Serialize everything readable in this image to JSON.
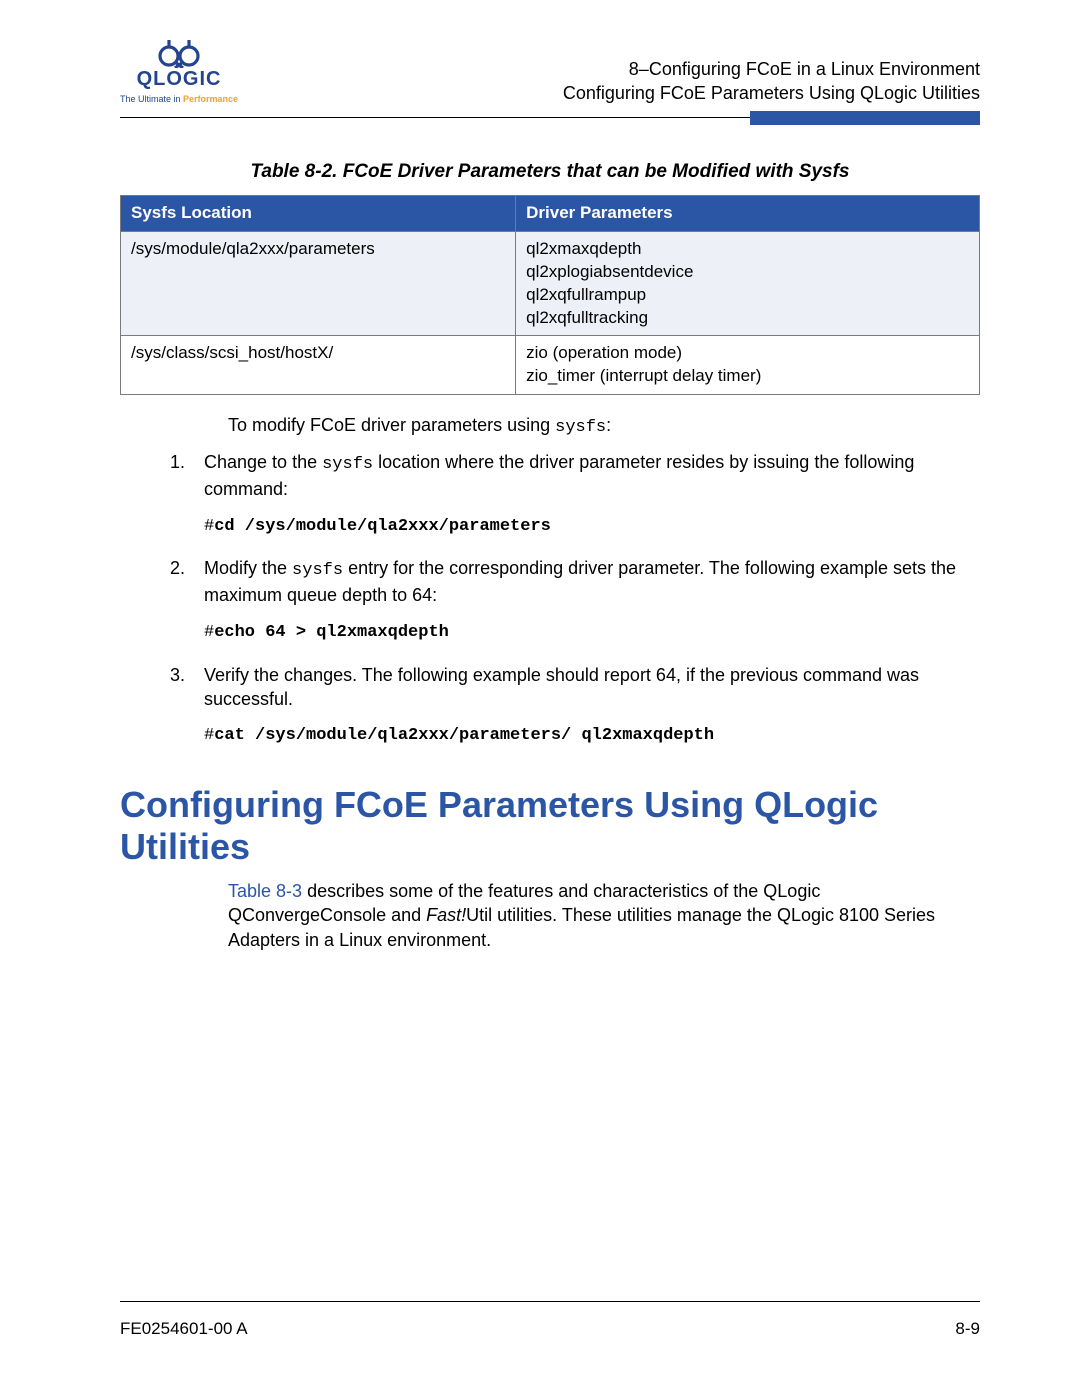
{
  "logo": {
    "brand": "QLOGIC",
    "tagline_prefix": "The Ultimate in ",
    "tagline_highlight": "Performance"
  },
  "header": {
    "line1": "8–Configuring FCoE in a Linux Environment",
    "line2": "Configuring FCoE Parameters Using QLogic Utilities"
  },
  "table": {
    "caption": "Table 8-2. FCoE Driver Parameters that can be Modified with Sysfs",
    "col1": "Sysfs Location",
    "col2": "Driver Parameters",
    "rows": [
      {
        "loc": "/sys/module/qla2xxx/parameters",
        "params": [
          "ql2xmaxqdepth",
          "ql2xplogiabsentdevice",
          "ql2xqfullrampup",
          "ql2xqfulltracking"
        ]
      },
      {
        "loc": "/sys/class/scsi_host/hostX/",
        "params": [
          "zio (operation mode)",
          "zio_timer (interrupt delay timer)"
        ]
      }
    ]
  },
  "intro_prefix": "To modify FCoE driver parameters using ",
  "intro_code": "sysfs",
  "intro_suffix": ":",
  "steps": {
    "s1_a": "Change to the ",
    "s1_code": "sysfs",
    "s1_b": " location where the driver parameter resides by issuing the following command:",
    "s1_cmd": "cd /sys/module/qla2xxx/parameters",
    "s2_a": "Modify the ",
    "s2_code": "sysfs",
    "s2_b": " entry for the corresponding driver parameter. The following example sets the maximum queue depth to 64:",
    "s2_cmd": "echo 64 > ql2xmaxqdepth",
    "s3": "Verify the changes. The following example should report 64, if the previous command was successful.",
    "s3_cmd": "cat /sys/module/qla2xxx/parameters/ ql2xmaxqdepth"
  },
  "section_heading": "Configuring FCoE Parameters Using QLogic Utilities",
  "section_body": {
    "link": "Table 8-3",
    "rest_a": " describes some of the features and characteristics of the QLogic QConvergeConsole and ",
    "fastutil": "Fast!",
    "rest_b": "Util utilities. These utilities manage the QLogic 8100 Series Adapters in a Linux environment."
  },
  "footer": {
    "left": "FE0254601-00 A",
    "right": "8-9"
  },
  "hash": "#"
}
